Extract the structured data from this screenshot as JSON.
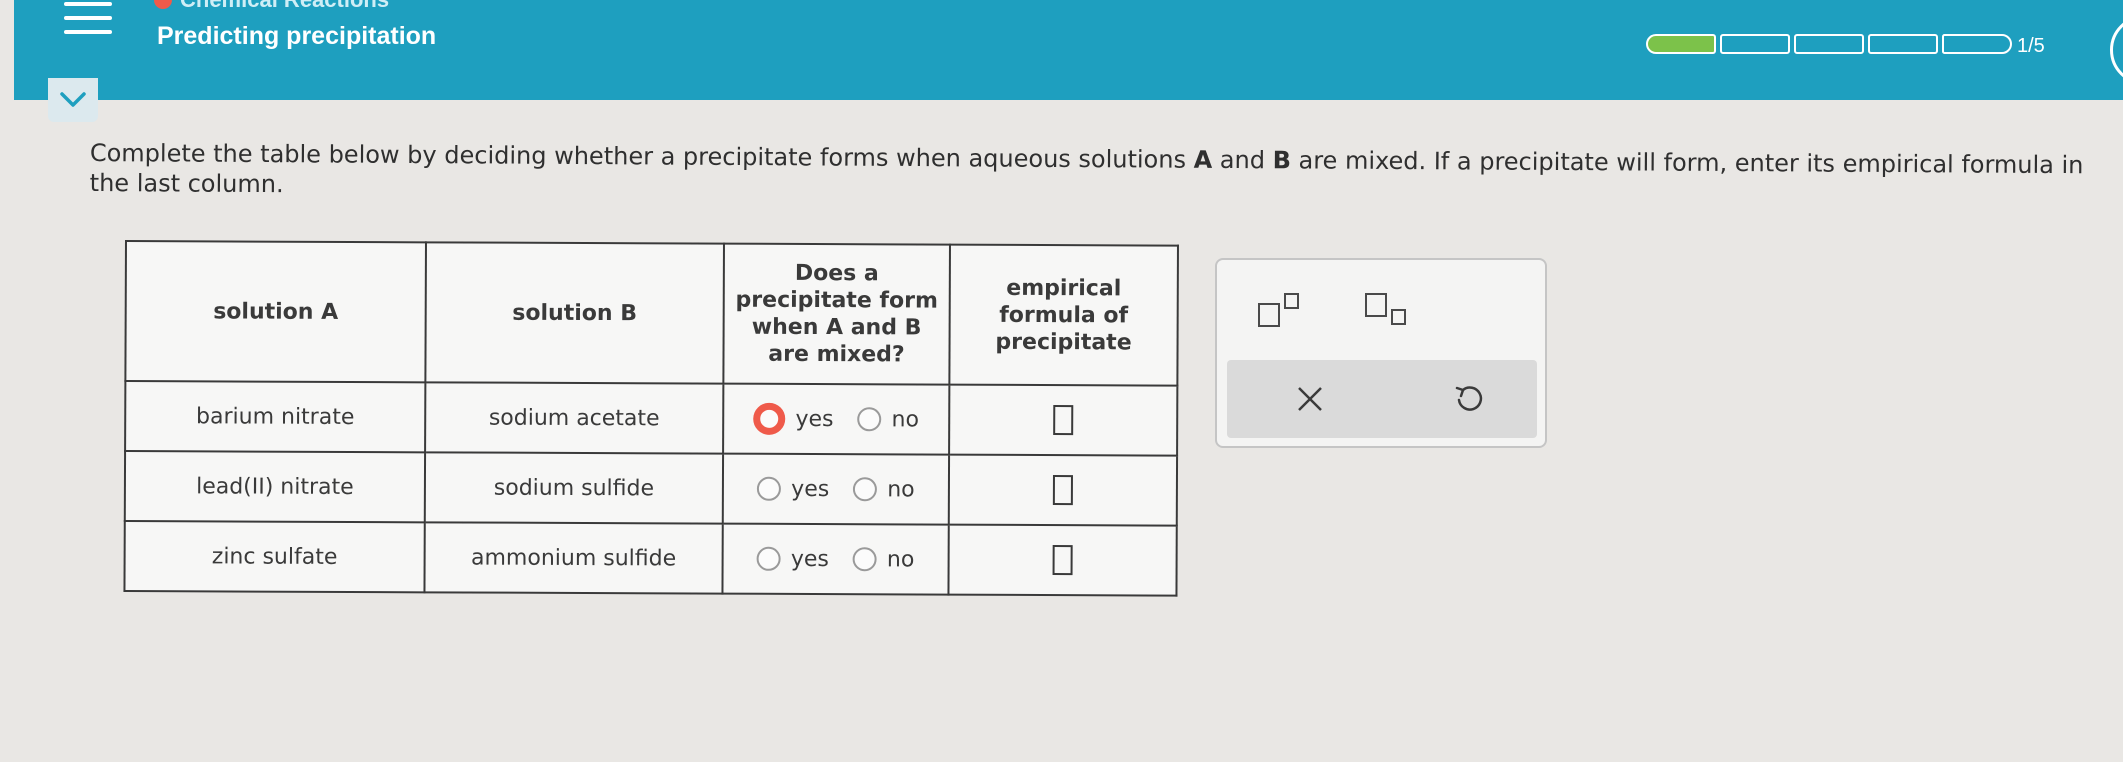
{
  "header": {
    "breadcrumb": "Chemical Reactions",
    "title": "Predicting precipitation",
    "progress": {
      "completed_segments": 1,
      "total_segments": 5,
      "label": "1/5"
    },
    "menu_icon": "hamburger-menu-icon",
    "collapse_icon": "chevron-down-icon"
  },
  "instructions": {
    "part1": "Complete the table below by deciding whether a precipitate forms when aqueous solutions ",
    "a": "A",
    "and": " and ",
    "b": "B",
    "part2": " are mixed. If a precipitate will form, enter its empirical formula in the last column."
  },
  "table": {
    "headers": {
      "solution_a": "solution A",
      "solution_b": "solution B",
      "precipitate_q": "Does a precipitate form when A and B are mixed?",
      "formula": "empirical formula of precipitate"
    },
    "option_yes": "yes",
    "option_no": "no",
    "rows": [
      {
        "solution_a": "barium nitrate",
        "solution_b": "sodium acetate"
      },
      {
        "solution_a": "lead(II) nitrate",
        "solution_b": "sodium sulfide"
      },
      {
        "solution_a": "zinc sulfate",
        "solution_b": "ammonium sulfide"
      }
    ]
  },
  "tools": {
    "superscript_icon": "superscript-icon",
    "subscript_icon": "subscript-icon",
    "clear_icon": "x-icon",
    "undo_icon": "undo-icon"
  },
  "colors": {
    "header_bg": "#1e9fbf",
    "progress_done": "#7cc24a",
    "focus_ring": "#ef5a4a"
  }
}
